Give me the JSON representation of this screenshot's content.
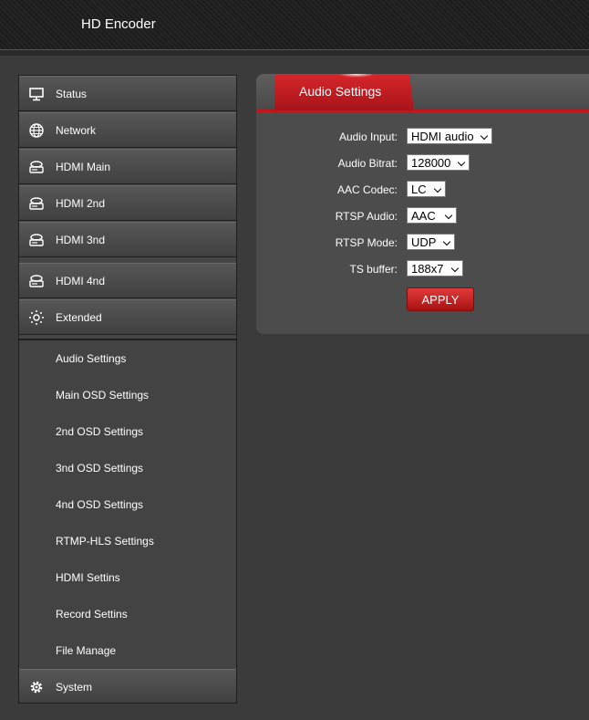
{
  "header": {
    "title": "HD Encoder"
  },
  "sidebar": {
    "items": [
      {
        "label": "Status",
        "icon": "monitor-icon"
      },
      {
        "label": "Network",
        "icon": "globe-icon"
      },
      {
        "label": "HDMI Main",
        "icon": "drive-icon"
      },
      {
        "label": "HDMI 2nd",
        "icon": "drive-icon"
      },
      {
        "label": "HDMI 3nd",
        "icon": "drive-icon"
      },
      {
        "label": "HDMI 4nd",
        "icon": "drive-icon"
      },
      {
        "label": "Extended",
        "icon": "gear-dots-icon"
      }
    ],
    "sub_items": [
      "Audio Settings",
      "Main OSD Settings",
      "2nd OSD Settings",
      "3nd OSD Settings",
      "4nd OSD Settings",
      "RTMP-HLS Settings",
      "HDMI Settins",
      "Record Settins",
      "File Manage"
    ],
    "system": {
      "label": "System",
      "icon": "gear-icon"
    }
  },
  "panel": {
    "tab_label": "Audio Settings",
    "fields": [
      {
        "label": "Audio Input:",
        "value": "HDMI audio"
      },
      {
        "label": "Audio Bitrat:",
        "value": "128000"
      },
      {
        "label": "AAC Codec:",
        "value": "LC"
      },
      {
        "label": "RTSP Audio:",
        "value": "AAC"
      },
      {
        "label": "RTSP Mode:",
        "value": "UDP"
      },
      {
        "label": "TS buffer:",
        "value": "188x7"
      }
    ],
    "apply_label": "APPLY"
  },
  "colors": {
    "accent": "#c3161c",
    "background": "#3b3b3b",
    "sidebar": "#454545"
  }
}
